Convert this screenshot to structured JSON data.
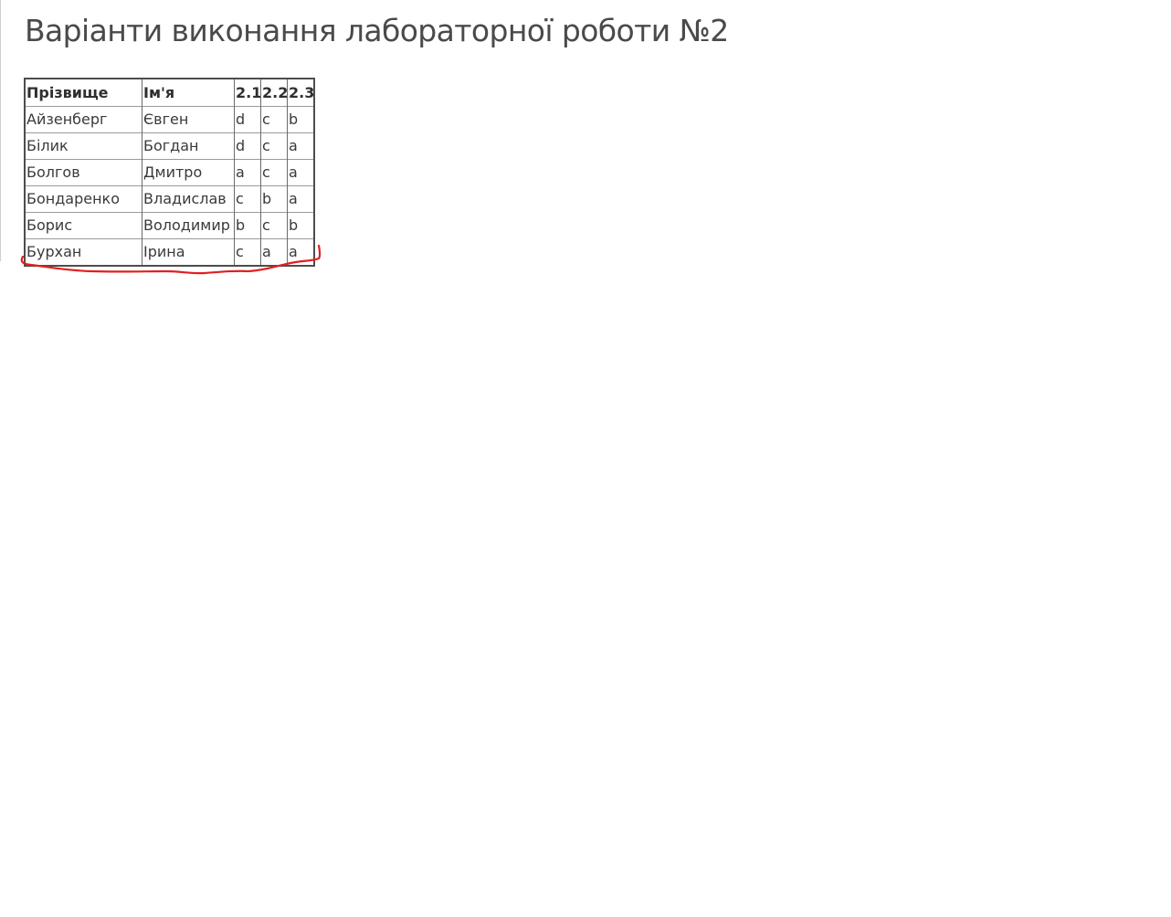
{
  "page": {
    "title": "Варіанти виконання лабораторної роботи №2"
  },
  "table": {
    "headers": {
      "surname": "Прізвище",
      "name": "Ім'я",
      "v1": "2.1",
      "v2": "2.2",
      "v3": "2.3"
    },
    "rows": [
      {
        "surname": "Айзенберг",
        "name": "Євген",
        "v1": "d",
        "v2": "c",
        "v3": "b"
      },
      {
        "surname": "Білик",
        "name": "Богдан",
        "v1": "d",
        "v2": "c",
        "v3": "a"
      },
      {
        "surname": "Болгов",
        "name": "Дмитро",
        "v1": "a",
        "v2": "c",
        "v3": "a"
      },
      {
        "surname": "Бондаренко",
        "name": "Владислав",
        "v1": "c",
        "v2": "b",
        "v3": "a"
      },
      {
        "surname": "Борис",
        "name": "Володимир",
        "v1": "b",
        "v2": "c",
        "v3": "b"
      },
      {
        "surname": "Бурхан",
        "name": "Ірина",
        "v1": "c",
        "v2": "a",
        "v3": "a"
      }
    ]
  },
  "colors": {
    "annotation_stroke": "#e0201f",
    "text": "#333333"
  }
}
